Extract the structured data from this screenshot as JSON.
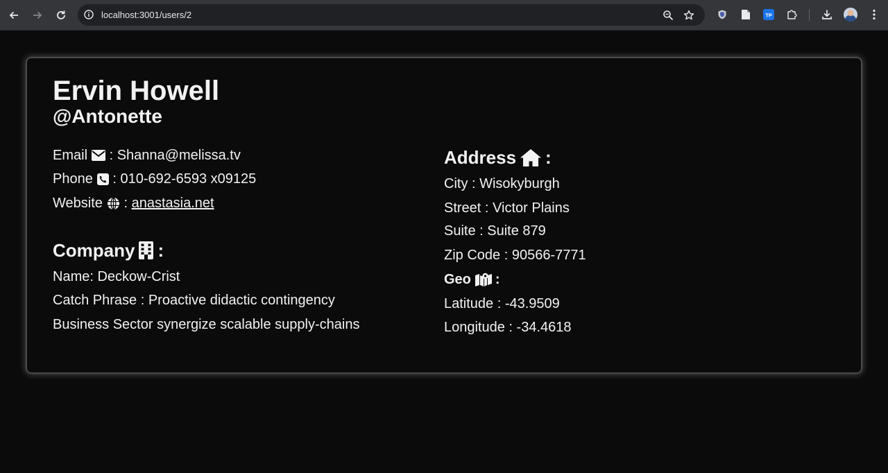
{
  "browser": {
    "url": "localhost:3001/users/2"
  },
  "user": {
    "name": "Ervin Howell",
    "username": "@Antonette"
  },
  "contact": {
    "email_label": "Email",
    "email": "Shanna@melissa.tv",
    "phone_label": "Phone",
    "phone": "010-692-6593 x09125",
    "website_label": "Website",
    "website": "anastasia.net",
    "separator": ":"
  },
  "company": {
    "heading": "Company",
    "name_line": "Name: Deckow-Crist",
    "catch_phrase_line": "Catch Phrase : Proactive didactic contingency",
    "bs_line": "Business Sector synergize scalable supply-chains"
  },
  "address": {
    "heading": "Address",
    "city_line": "City : Wisokyburgh",
    "street_line": "Street : Victor Plains",
    "suite_line": "Suite : Suite 879",
    "zip_line": "Zip Code : 90566-7771",
    "geo_heading": "Geo",
    "lat_line": "Latitude : -43.9509",
    "lng_line": "Longitude : -34.4618"
  },
  "icons": {
    "email": "envelope-icon",
    "phone": "phone-square-icon",
    "website": "globe-icon",
    "company": "building-icon",
    "address": "house-icon",
    "geo": "map-location-icon"
  }
}
